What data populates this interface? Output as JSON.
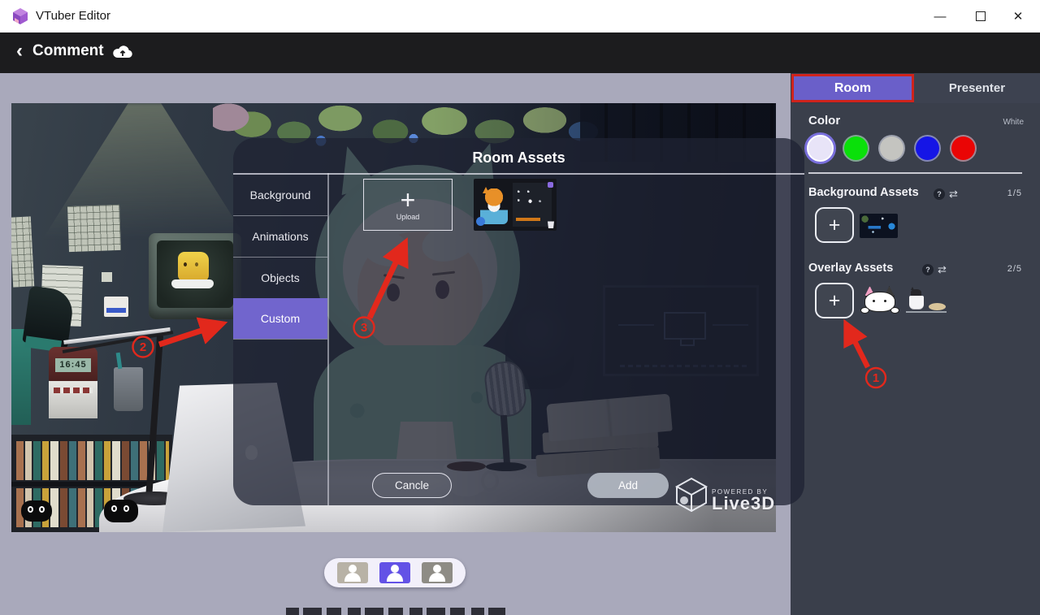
{
  "window": {
    "app_title": "VTuber Editor",
    "minimize_label": "—",
    "close_label": "✕"
  },
  "toolbar": {
    "back_icon": "‹",
    "back_label": "Comment"
  },
  "scene": {
    "clock_time": "16:45"
  },
  "sidebar": {
    "tabs": [
      {
        "label": "Room",
        "active": true
      },
      {
        "label": "Presenter",
        "active": false
      }
    ],
    "color": {
      "label": "Color",
      "selected_name": "White",
      "swatches": [
        {
          "name": "White",
          "hex": "#e8e4f8",
          "selected": true
        },
        {
          "name": "Green",
          "hex": "#0ae00a",
          "selected": false
        },
        {
          "name": "Gray",
          "hex": "#c4c4c0",
          "selected": false
        },
        {
          "name": "Blue",
          "hex": "#1515e6",
          "selected": false
        },
        {
          "name": "Red",
          "hex": "#ea0505",
          "selected": false
        }
      ]
    },
    "sections": [
      {
        "title": "Background Assets",
        "count": "1/5"
      },
      {
        "title": "Overlay Assets",
        "count": "2/5"
      }
    ],
    "icons": {
      "help": "?",
      "swap": "⇄"
    },
    "add_symbol": "+"
  },
  "modal": {
    "title": "Room Assets",
    "tabs": [
      {
        "label": "Background",
        "active": false
      },
      {
        "label": "Animations",
        "active": false
      },
      {
        "label": "Objects",
        "active": false
      },
      {
        "label": "Custom",
        "active": true
      }
    ],
    "upload_plus": "+",
    "upload_label": "Upload",
    "cancel_label": "Cancle",
    "add_label": "Add"
  },
  "watermark": {
    "line1": "POWERED BY",
    "line2": "Live3D"
  },
  "annotations": {
    "color": "#e2281c",
    "steps": [
      {
        "label": "1"
      },
      {
        "label": "2"
      },
      {
        "label": "3"
      }
    ]
  },
  "colors": {
    "accent_purple": "#6a5fc9",
    "custom_tab_purple": "#7165cd",
    "annotation_red": "#cf231c",
    "toolbar_black": "#1c1c1e",
    "sidebar_gray": "#3a3f4b"
  }
}
